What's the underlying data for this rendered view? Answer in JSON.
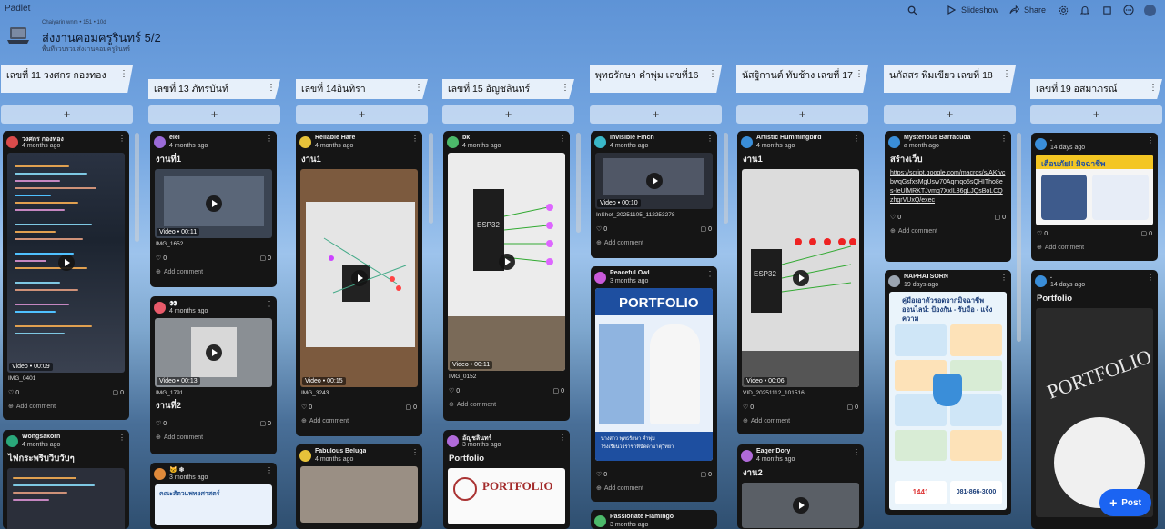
{
  "app": {
    "name": "Padlet"
  },
  "toolbar": {
    "slideshow": "Slideshow",
    "share": "Share"
  },
  "header": {
    "author_meta": "Chaiyarin wnm • 151 • 10d",
    "title": "ส่งงานคอมครูรินทร์ 5/2",
    "subtitle": "พื้นที่รวบรวมส่งงานคอมครูรินทร์"
  },
  "columns": [
    {
      "title": "เลขที่ 11 วงศกร กองทอง",
      "add": "+"
    },
    {
      "title": "เลขที่ 13 ภัทรบันท์",
      "add": "+"
    },
    {
      "title": "เลขที่ 14อินทิรา",
      "add": "+"
    },
    {
      "title": "เลขที่ 15 อัญชลินทร์",
      "add": "+"
    },
    {
      "title": "พุทธรักษา คำพุ่ม เลขที่16",
      "add": "+"
    },
    {
      "title": "นัสฐิกานต์ ทับช้าง เลขที่ 17",
      "add": "+"
    },
    {
      "title": "นภัสสร พิมเขียว เลขที่ 18",
      "add": "+"
    },
    {
      "title": "เลขที่ 19 อสมาภรณ์",
      "add": "+"
    }
  ],
  "cards": {
    "c1a": {
      "name": "วงศกร กองทอง",
      "time": "4 months ago",
      "video": "Video • 00:09",
      "file": "IMG_0401",
      "likes": "0",
      "comments": "0",
      "add": "Add comment"
    },
    "c1b": {
      "name": "Wongsakorn",
      "time": "4 months ago",
      "title": "ไฟกระพริบวิบวับๆ"
    },
    "c2a": {
      "name": "eiei",
      "time": "4 months ago",
      "title": "งานที่1",
      "video": "Video • 00:11",
      "file": "IMG_1652",
      "likes": "0",
      "comments": "0",
      "add": "Add comment"
    },
    "c2b": {
      "name": "👀",
      "time": "4 months ago",
      "video": "Video • 00:13",
      "file": "IMG_1791",
      "title2": "งานที่2",
      "likes": "0",
      "comments": "0",
      "add": "Add comment"
    },
    "c2c": {
      "name": "🐱 ❄",
      "time": "3 months ago",
      "img_text": "คณะสัตวแพทยศาสตร์"
    },
    "c3a": {
      "name": "Reliable Hare",
      "time": "4 months ago",
      "title": "งาน1",
      "video": "Video • 00:15",
      "file": "IMG_3243",
      "likes": "0",
      "comments": "0",
      "add": "Add comment"
    },
    "c3b": {
      "name": "Fabulous Beluga",
      "time": "4 months ago"
    },
    "c4a": {
      "name": "bk",
      "time": "4 months ago",
      "video": "Video • 00:11",
      "file": "IMG_0152",
      "likes": "0",
      "comments": "0",
      "add": "Add comment",
      "esp": "ESP32"
    },
    "c4b": {
      "name": "อัญชลินทร์",
      "time": "3 months ago",
      "title": "Portfolio",
      "img_text": "PORTFOLIO"
    },
    "c5a": {
      "name": "Invisible Finch",
      "time": "4 months ago",
      "video": "Video • 00:10",
      "file": "InShot_20251105_112253278",
      "likes": "0",
      "comments": "0",
      "add": "Add comment"
    },
    "c5b": {
      "name": "Peaceful Owl",
      "time": "3 months ago",
      "img_text": "PORTFOLIO",
      "img_caption": "นางสาว พุทธรักษา คำพุ่ม",
      "img_school": "โรงเรียนวรราชาทินัดดามาตุวิทยา",
      "likes": "0",
      "comments": "0",
      "add": "Add comment"
    },
    "c5c": {
      "name": "Passionate Flamingo",
      "time": "3 months ago"
    },
    "c6a": {
      "name": "Artistic Hummingbird",
      "time": "4 months ago",
      "title": "งาน1",
      "video": "Video • 00:06",
      "file": "VID_20251112_101516",
      "likes": "0",
      "comments": "0",
      "add": "Add comment",
      "esp": "ESP32"
    },
    "c6b": {
      "name": "Eager Dory",
      "time": "4 months ago",
      "title": "งาน2"
    },
    "c7a": {
      "name": "Mysterious Barracuda",
      "time": "a month ago",
      "title": "สร้างเว็บ",
      "link": "https://script.google.com/macros/s/AKfycbwqGsfxsMgUsw70Aqmqo5sQHITho8es-IeUlMRKTJvmq7XxIL86gLJQsBoLCQzhgrVUxQ/exec",
      "likes": "0",
      "comments": "0",
      "add": "Add comment"
    },
    "c7b": {
      "name": "NAPHATSORN",
      "time": "19 days ago",
      "img_title": "คู่มือเอาตัวรอดจากมิจฉาชีพออนไลน์: ป้องกัน - รับมือ - แจ้งความ",
      "img_phone1": "1441",
      "img_phone2": "081-866-3000"
    },
    "c8a": {
      "name": ".",
      "time": "14 days ago",
      "img_text": "เตือนภัย!! มิจฉาชีพ",
      "likes": "0",
      "comments": "0",
      "add": "Add comment"
    },
    "c8b": {
      "name": ".",
      "time": "14 days ago",
      "title": "Portfolio",
      "img_text": "PORTFOLIO"
    }
  },
  "post_button": "Post",
  "colors": {
    "accent": "#1b64f2",
    "card": "#151515"
  }
}
